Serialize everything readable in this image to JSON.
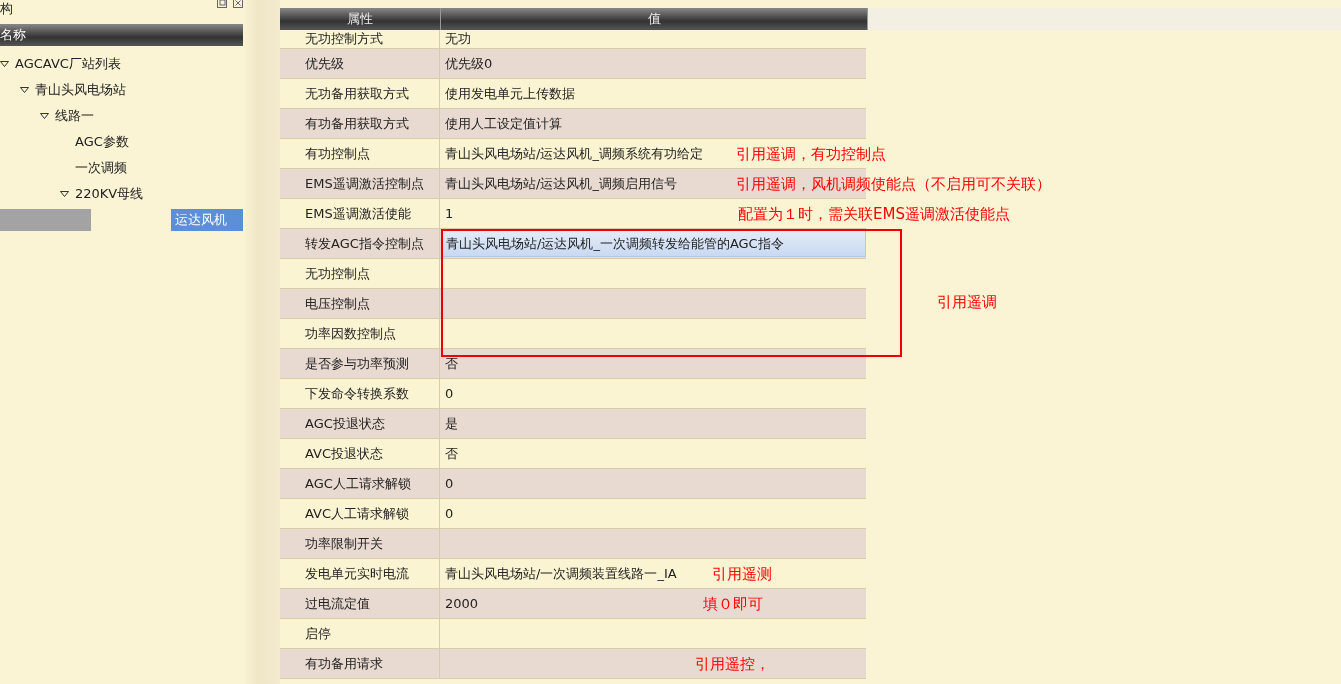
{
  "left_panel": {
    "title": "构",
    "column_header": "名称",
    "tree": [
      {
        "label": "AGCAVC厂站列表",
        "expanded": true,
        "selected": false,
        "children": [
          {
            "label": "青山头风电场站",
            "expanded": true,
            "selected": false,
            "children": [
              {
                "label": "线路一",
                "expanded": true,
                "selected": false,
                "children": [
                  {
                    "label": "AGC参数",
                    "selected": false
                  },
                  {
                    "label": "一次调频",
                    "selected": false
                  },
                  {
                    "label": "220KV母线",
                    "expanded": true,
                    "selected": false,
                    "children": [
                      {
                        "label": "运达风机",
                        "selected": true
                      }
                    ]
                  }
                ]
              }
            ]
          }
        ]
      }
    ]
  },
  "table": {
    "columns": [
      "属性",
      "值"
    ],
    "rows": [
      {
        "property": "无功控制方式",
        "value": "无功",
        "selected": false
      },
      {
        "property": "优先级",
        "value": "优先级0",
        "selected": false
      },
      {
        "property": "无功备用获取方式",
        "value": "使用发电单元上传数据",
        "selected": false
      },
      {
        "property": "有功备用获取方式",
        "value": "使用人工设定值计算",
        "selected": false
      },
      {
        "property": "有功控制点",
        "value": "青山头风电场站/运达风机_调频系统有功给定",
        "selected": false,
        "note": "引用遥调，有功控制点"
      },
      {
        "property": "EMS遥调激活控制点",
        "value": "青山头风电场站/运达风机_调频启用信号",
        "selected": false,
        "note": "引用遥调，风机调频使能点（不启用可不关联）"
      },
      {
        "property": "EMS遥调激活使能",
        "value": "1",
        "selected": false,
        "note": "配置为１时，需关联EMS遥调激活使能点"
      },
      {
        "property": "转发AGC指令控制点",
        "value": "青山头风电场站/运达风机_一次调频转发给能管的AGC指令",
        "selected": true
      },
      {
        "property": "无功控制点",
        "value": "",
        "selected": false
      },
      {
        "property": "电压控制点",
        "value": "",
        "selected": false
      },
      {
        "property": "功率因数控制点",
        "value": "",
        "selected": false
      },
      {
        "property": "是否参与功率预测",
        "value": "否",
        "selected": false
      },
      {
        "property": "下发命令转换系数",
        "value": "0",
        "selected": false
      },
      {
        "property": "AGC投退状态",
        "value": "是",
        "selected": false
      },
      {
        "property": "AVC投退状态",
        "value": "否",
        "selected": false
      },
      {
        "property": "AGC人工请求解锁",
        "value": "0",
        "selected": false
      },
      {
        "property": "AVC人工请求解锁",
        "value": "0",
        "selected": false
      },
      {
        "property": "功率限制开关",
        "value": "",
        "selected": false
      },
      {
        "property": "发电单元实时电流",
        "value": "青山头风电场站/一次调频装置线路一_IA",
        "selected": false,
        "note": "引用遥测"
      },
      {
        "property": "过电流定值",
        "value": "2000",
        "selected": false,
        "note": "填０即可"
      },
      {
        "property": "启停",
        "value": "",
        "selected": false
      },
      {
        "property": "有功备用请求",
        "value": "",
        "selected": false,
        "note": "引用遥控，"
      }
    ]
  },
  "side_note": "引用遥调"
}
